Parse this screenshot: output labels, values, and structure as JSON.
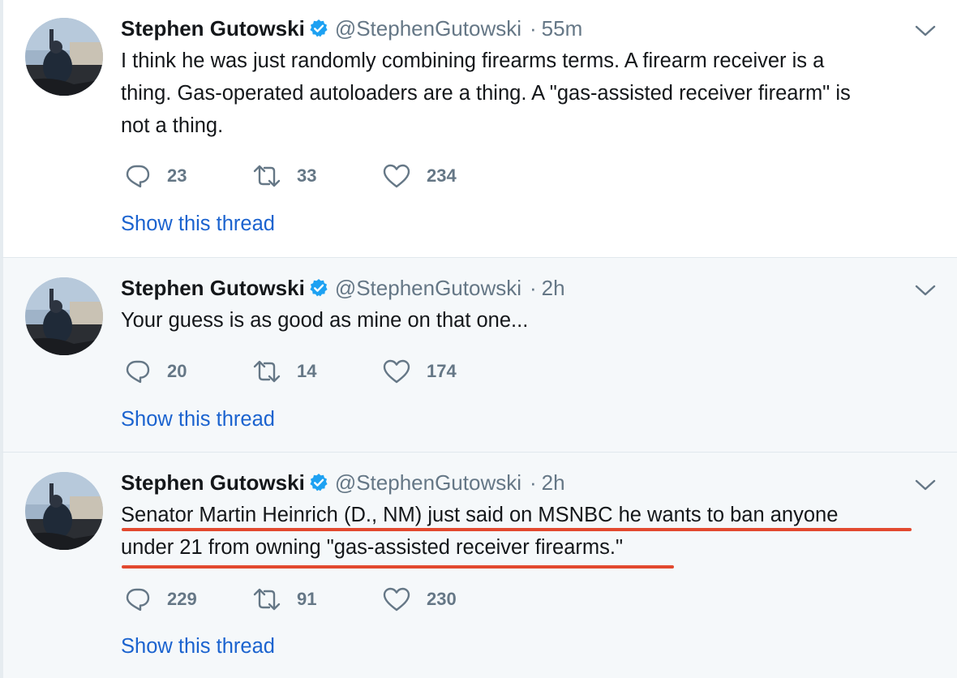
{
  "tweets": [
    {
      "name": "Stephen Gutowski",
      "handle": "@StephenGutowski",
      "time": "55m",
      "lines": [
        "I think he was just randomly combining firearms terms. A firearm receiver is a",
        "thing. Gas-operated autoloaders are a thing. A \"gas-assisted receiver firearm\" is",
        "not a thing."
      ],
      "replies": "23",
      "retweets": "33",
      "likes": "234",
      "thread_link": "Show this thread"
    },
    {
      "name": "Stephen Gutowski",
      "handle": "@StephenGutowski",
      "time": "2h",
      "lines": [
        "Your guess is as good as mine on that one..."
      ],
      "replies": "20",
      "retweets": "14",
      "likes": "174",
      "thread_link": "Show this thread"
    },
    {
      "name": "Stephen Gutowski",
      "handle": "@StephenGutowski",
      "time": "2h",
      "lines": [
        "Senator Martin Heinrich (D., NM) just said on MSNBC he wants to ban anyone",
        "under 21 from owning \"gas-assisted receiver firearms.\""
      ],
      "replies": "229",
      "retweets": "91",
      "likes": "230",
      "thread_link": "Show this thread"
    }
  ],
  "icons": {
    "reply": "reply-icon",
    "retweet": "retweet-icon",
    "like": "heart-icon",
    "verified": "verified-badge-icon",
    "caret": "chevron-down-icon"
  },
  "colors": {
    "link": "#1b63cf",
    "verified": "#1da1f2",
    "muted": "#657786",
    "annotation_underline": "#e2492f"
  }
}
